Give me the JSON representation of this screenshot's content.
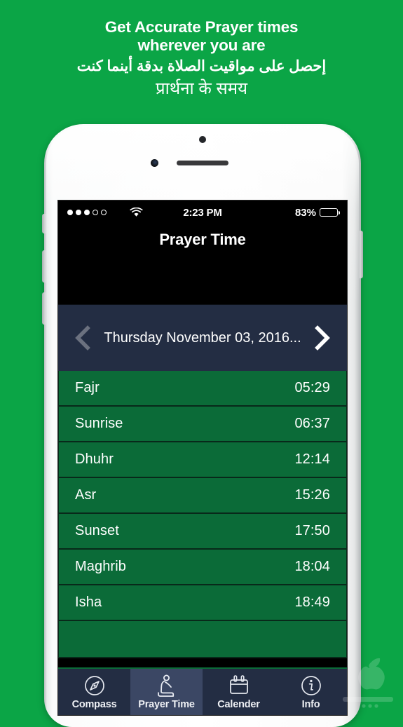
{
  "promo": {
    "line_en_1": "Get Accurate Prayer times",
    "line_en_2": "wherever you are",
    "line_ar": "إحصل على مواقيت الصلاة بدقة أينما كنت",
    "line_hi": "प्रार्थना के समय",
    "background_color": "#0ba546",
    "text_color": "#ffffff"
  },
  "phone": {
    "frame_color": "#ffffff",
    "screen_background": "#000000"
  },
  "status_bar": {
    "signal_dots_filled": 3,
    "signal_dots_empty": 2,
    "wifi_icon": "wifi-icon",
    "time": "2:23 PM",
    "battery_percent": "83%",
    "battery_level": 83
  },
  "nav": {
    "title": "Prayer Time"
  },
  "date_bar": {
    "background_color": "#232d43",
    "prev_icon": "chevron-left-icon",
    "next_icon": "chevron-right-icon",
    "date_text": "Thursday November 03, 2016...",
    "prev_enabled": false,
    "next_enabled": true
  },
  "prayer_list": {
    "row_color": "#0b6b38",
    "rows": [
      {
        "name": "Fajr",
        "time": "05:29"
      },
      {
        "name": "Sunrise",
        "time": "06:37"
      },
      {
        "name": "Dhuhr",
        "time": "12:14"
      },
      {
        "name": "Asr",
        "time": "15:26"
      },
      {
        "name": "Sunset",
        "time": "17:50"
      },
      {
        "name": "Maghrib",
        "time": "18:04"
      },
      {
        "name": "Isha",
        "time": "18:49"
      }
    ]
  },
  "tab_bar": {
    "background_color": "#232d43",
    "selected_color": "#3b4764",
    "accent_color": "#0b6b38",
    "tabs": [
      {
        "label": "Compass",
        "icon": "compass-icon",
        "selected": false
      },
      {
        "label": "Prayer Time",
        "icon": "praying-icon",
        "selected": true
      },
      {
        "label": "Calender",
        "icon": "calendar-icon",
        "selected": false
      },
      {
        "label": "Info",
        "icon": "info-icon",
        "selected": false
      }
    ]
  }
}
